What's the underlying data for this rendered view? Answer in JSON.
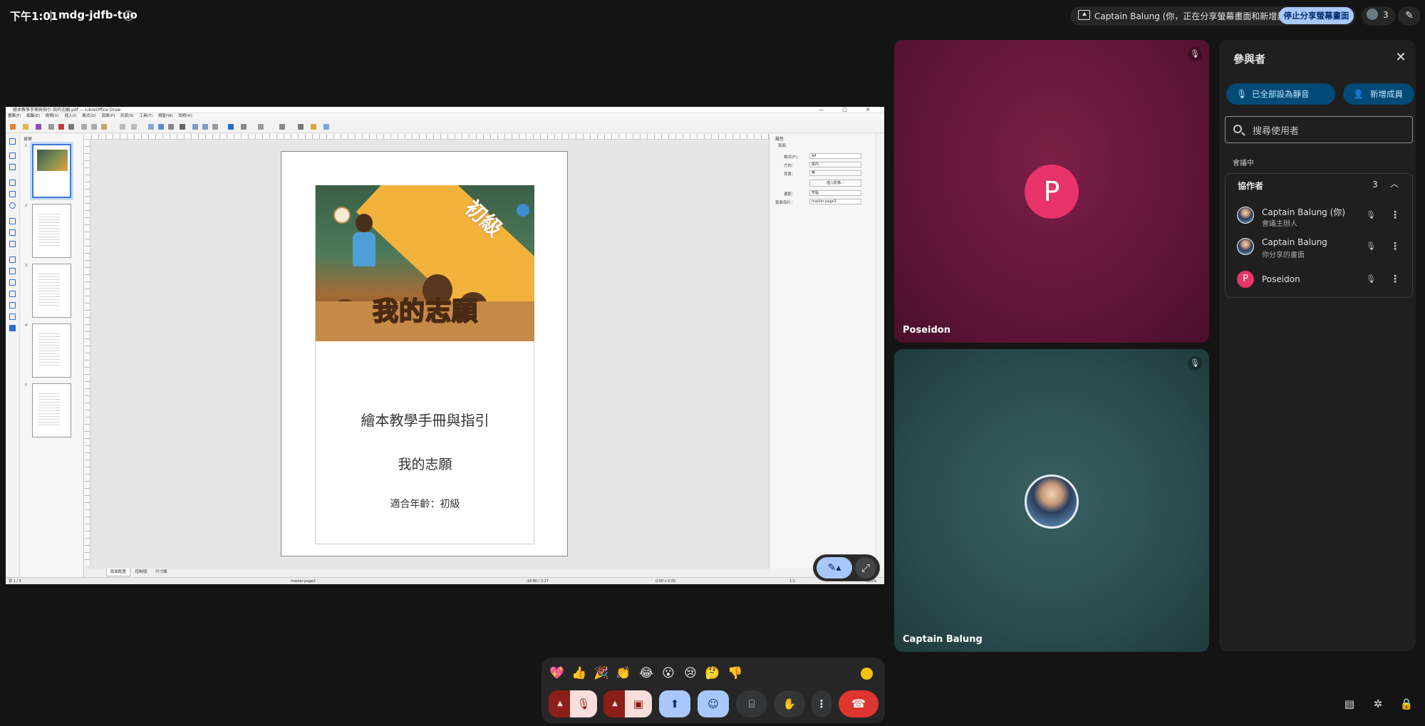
{
  "topbar": {
    "time": "下午1:01",
    "separator": "|",
    "meeting_code": "mdg-jdfb-tuo",
    "info_icon": "info-icon",
    "share_status": "Captain Balung (你，正在分享螢幕畫面和新增註解)",
    "stop_share_label": "停止分享螢幕畫面",
    "participant_count": "3",
    "host_tools_icon": "pen-icon"
  },
  "presentation": {
    "window_title": "繪本教學手冊與指引-我的志願.pdf — LibreOffice Draw",
    "window_controls": "— ▢ ✕",
    "menu": [
      "檔案(F)",
      "編輯(E)",
      "檢視(V)",
      "插入(I)",
      "格式(O)",
      "頁面(P)",
      "形狀(S)",
      "工具(T)",
      "視窗(W)",
      "說明(H)"
    ],
    "slide_panel_title": "頁面",
    "page_numbers": [
      "1",
      "2",
      "3",
      "4",
      "5"
    ],
    "cover_banner": "初級",
    "cover_title": "我的志願",
    "doc_title": "繪本教學手冊與指引",
    "doc_subtitle": "我的志願",
    "doc_age": "適合年齡：初級",
    "sidebar": {
      "title": "屬性",
      "section": "頁面",
      "format_label": "格式(F)：",
      "format_value": "A4",
      "orientation_label": "方向：",
      "orientation_value": "縱向",
      "background_label": "背景：",
      "background_value": "無",
      "insert_image": "插入影像...",
      "margins_label": "邊距：",
      "margins_value": "窄幅",
      "master_label": "頁面母片：",
      "master_value": "master-page3"
    },
    "tabs": [
      "版面配置",
      "控制項",
      "尺寸線"
    ],
    "status": {
      "page": "頁 1 / 5",
      "master": "master-page3",
      "position": "-18.80 / 3.27",
      "size": "0.00 x 0.00",
      "scale": "1:1",
      "zoom": "105%"
    },
    "float_annotate_icon": "annotate-icon",
    "float_expand_icon": "expand-icon"
  },
  "tiles": [
    {
      "name": "Poseidon",
      "initial": "P",
      "color": "#e8336b",
      "muted": true
    },
    {
      "name": "Captain Balung",
      "muted": true
    }
  ],
  "panel": {
    "title": "參與者",
    "mute_all": "已全部設為靜音",
    "add_member": "新增成員",
    "search_placeholder": "搜尋使用者",
    "section_label": "會議中",
    "group_title": "協作者",
    "group_count": "3",
    "participants": [
      {
        "name": "Captain Balung (你)",
        "sub": "會議主辦人",
        "avatar": "photo"
      },
      {
        "name": "Captain Balung",
        "sub": "你分享的畫面",
        "avatar": "photo"
      },
      {
        "name": "Poseidon",
        "sub": "",
        "avatar": "P"
      }
    ]
  },
  "reactions": [
    "💖",
    "👍",
    "🎉",
    "👏",
    "😂",
    "😮",
    "😢",
    "🤔",
    "👎"
  ],
  "controls": {
    "mic": "mic-off-icon",
    "camera": "camera-off-icon",
    "present": "present-icon",
    "emoji": "emoji-icon",
    "captions": "captions-icon",
    "raise_hand": "raise-hand-icon",
    "more": "more-icon",
    "hangup": "hangup-icon"
  },
  "bottom_right": [
    "chat-icon",
    "activities-icon",
    "lock-icon"
  ]
}
